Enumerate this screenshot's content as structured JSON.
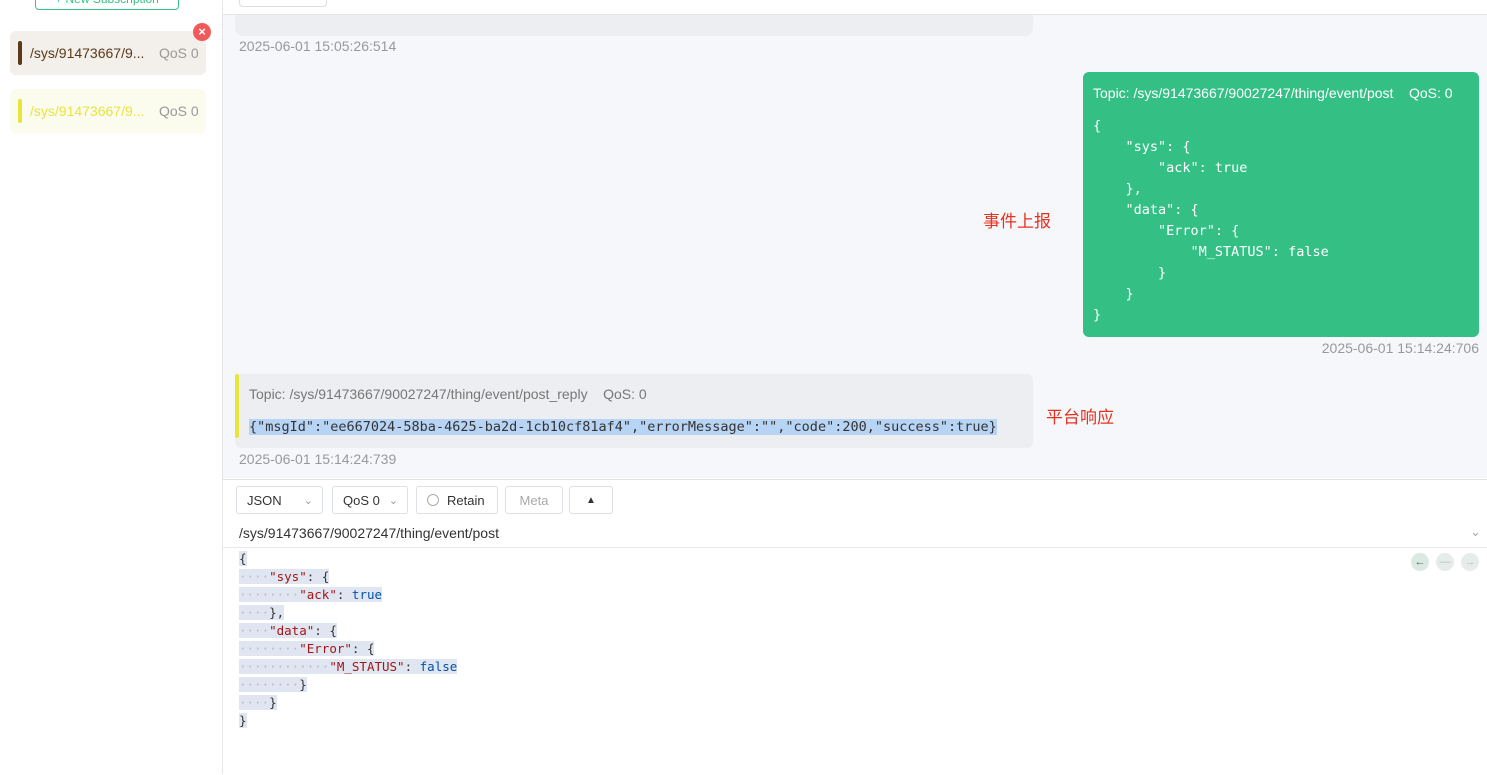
{
  "sidebar": {
    "new_subscription_label": "+ New Subscription",
    "subscriptions": [
      {
        "topic": "/sys/91473667/9...",
        "qos": "QoS 0",
        "color": "#5a3a1a",
        "bg": "#f3efea"
      },
      {
        "topic": "/sys/91473667/9...",
        "qos": "QoS 0",
        "color": "#e8e53c",
        "bg": "#fbfbee"
      }
    ]
  },
  "messages": {
    "prev_timestamp": "2025-06-01 15:05:26:514",
    "sent": {
      "header": "Topic: /sys/91473667/90027247/thing/event/post    QoS: 0",
      "payload": "{\n    \"sys\": {\n        \"ack\": true\n    },\n    \"data\": {\n        \"Error\": {\n            \"M_STATUS\": false\n        }\n    }\n}",
      "timestamp": "2025-06-01 15:14:24:706",
      "annotation": "事件上报"
    },
    "received": {
      "header": "Topic: /sys/91473667/90027247/thing/event/post_reply    QoS: 0",
      "payload": "{\"msgId\":\"ee667024-58ba-4625-ba2d-1cb10cf81af4\",\"errorMessage\":\"\",\"code\":200,\"success\":true}",
      "timestamp": "2025-06-01 15:14:24:739",
      "annotation": "平台响应"
    }
  },
  "composer": {
    "format": "JSON",
    "qos": "QoS 0",
    "retain_label": "Retain",
    "meta_label": "Meta",
    "topic": "/sys/91473667/90027247/thing/event/post",
    "editor_lines": [
      {
        "indent": "",
        "parts": [
          {
            "t": "{",
            "c": ""
          }
        ]
      },
      {
        "indent": "····",
        "parts": [
          {
            "t": "\"sys\"",
            "c": "k"
          },
          {
            "t": ": {",
            "c": ""
          }
        ]
      },
      {
        "indent": "········",
        "parts": [
          {
            "t": "\"ack\"",
            "c": "k"
          },
          {
            "t": ": ",
            "c": ""
          },
          {
            "t": "true",
            "c": "v"
          }
        ]
      },
      {
        "indent": "····",
        "parts": [
          {
            "t": "},",
            "c": ""
          }
        ]
      },
      {
        "indent": "····",
        "parts": [
          {
            "t": "\"data\"",
            "c": "k"
          },
          {
            "t": ": {",
            "c": ""
          }
        ]
      },
      {
        "indent": "········",
        "parts": [
          {
            "t": "\"Error\"",
            "c": "k"
          },
          {
            "t": ": {",
            "c": ""
          }
        ]
      },
      {
        "indent": "············",
        "parts": [
          {
            "t": "\"M_STATUS\"",
            "c": "k"
          },
          {
            "t": ": ",
            "c": ""
          },
          {
            "t": "false",
            "c": "v"
          }
        ]
      },
      {
        "indent": "········",
        "parts": [
          {
            "t": "}",
            "c": ""
          }
        ]
      },
      {
        "indent": "····",
        "parts": [
          {
            "t": "}",
            "c": ""
          }
        ]
      },
      {
        "indent": "",
        "parts": [
          {
            "t": "}",
            "c": ""
          }
        ]
      }
    ]
  },
  "icons": {
    "close": "close-icon",
    "chevron": "chevron-down-icon",
    "arrow_left": "arrow-left-icon",
    "minus": "minus-icon",
    "arrow_right": "arrow-right-icon",
    "triangle_up": "triangle-up-icon"
  }
}
